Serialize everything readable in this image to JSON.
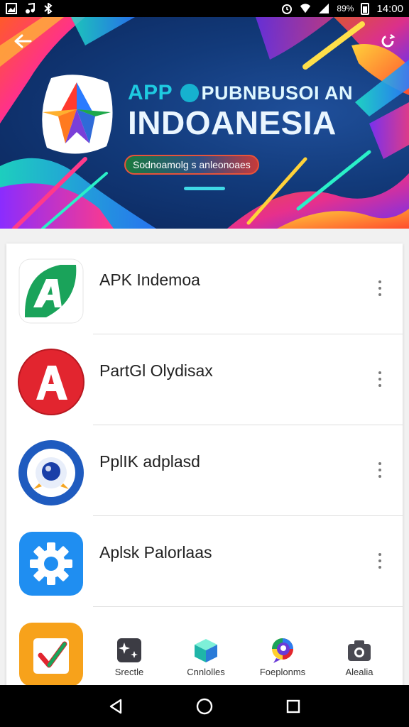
{
  "status_bar": {
    "battery_percent": "89%",
    "time": "14:00"
  },
  "banner": {
    "title_line1_a": "APP",
    "title_line1_b": "PUBNBUSOI AN",
    "title_line2": "INDOANESIA",
    "tagline": "Sodnoamolg s anleonoaes",
    "back_icon": "arrow-left-icon",
    "share_icon": "share-icon",
    "accent_color": "#1ecbe1"
  },
  "apps": [
    {
      "name": "APK Indemoa",
      "icon": "green-a-icon",
      "color": "#1aa35a"
    },
    {
      "name": "PartGl Olydisax",
      "icon": "red-a-icon",
      "color": "#e2252f"
    },
    {
      "name": "PplIK adplasd",
      "icon": "blue-camera-icon",
      "color": "#1f5bbf"
    },
    {
      "name": "Aplsk Palorlaas",
      "icon": "gear-icon",
      "color": "#1f8ef1"
    },
    {
      "name": "",
      "icon": "checkmark-icon",
      "color": "#f7a21b"
    }
  ],
  "tabs": [
    {
      "label": "Srectle",
      "icon": "sparkle-image-icon"
    },
    {
      "label": "Cnnlolles",
      "icon": "cube-icon"
    },
    {
      "label": "Foeplonms",
      "icon": "chat-bubble-icon"
    },
    {
      "label": "Alealia",
      "icon": "camera-icon"
    }
  ],
  "nav": {
    "back_icon": "triangle-back-icon",
    "home_icon": "circle-home-icon",
    "recents_icon": "square-recents-icon"
  }
}
